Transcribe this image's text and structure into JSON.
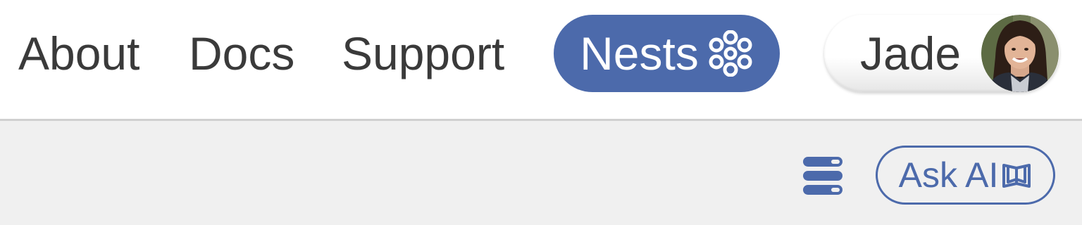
{
  "nav": {
    "items": [
      {
        "label": "About"
      },
      {
        "label": "Docs"
      },
      {
        "label": "Support"
      }
    ],
    "nests": {
      "label": "Nests",
      "icon": "nests-ring-icon"
    }
  },
  "user": {
    "name": "Jade",
    "avatar": "user-avatar-photo"
  },
  "toolbar": {
    "menu_icon": "list-menu-icon",
    "ask_ai": {
      "label": "Ask AI",
      "icon": "book-icon"
    }
  },
  "colors": {
    "accent": "#4c6aab",
    "text": "#3a3a3a",
    "subbar_bg": "#f0f0f0",
    "divider": "#d0d0d0"
  }
}
